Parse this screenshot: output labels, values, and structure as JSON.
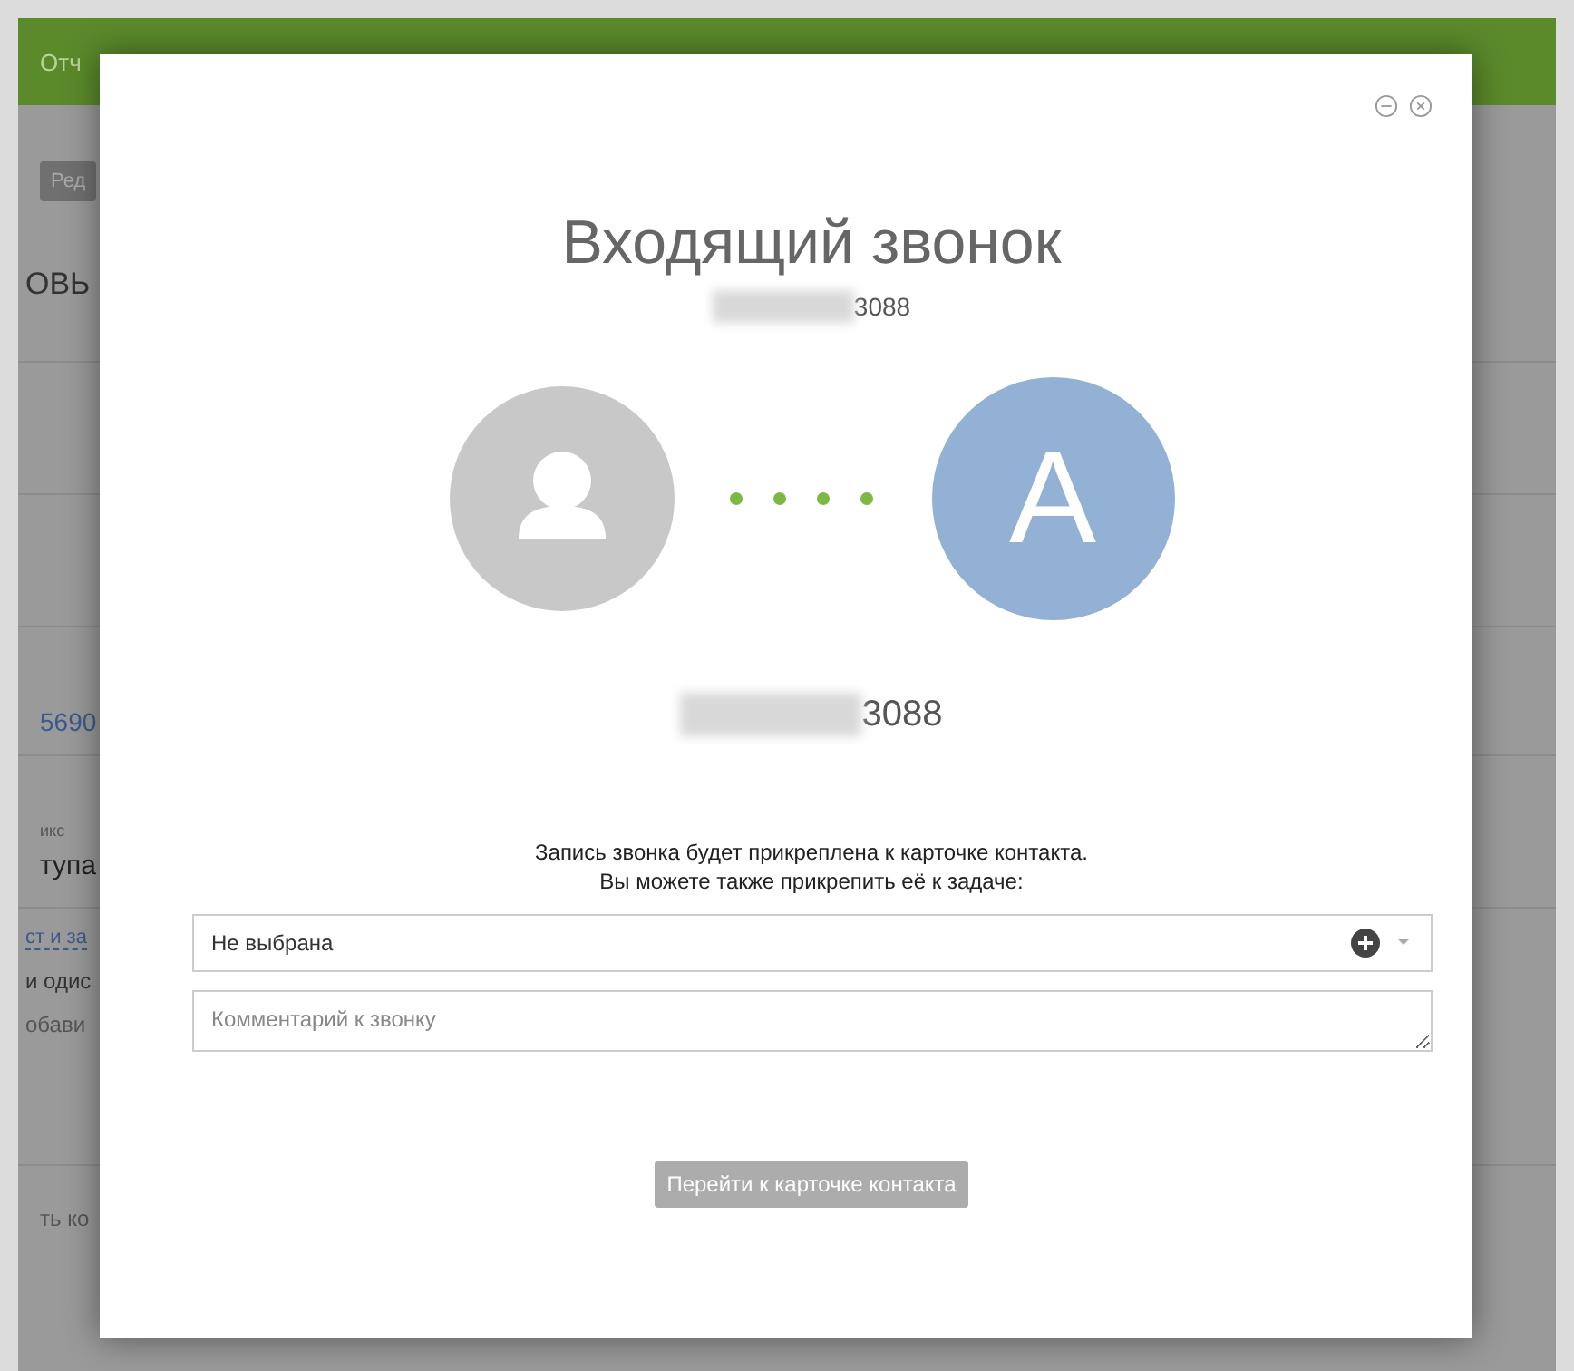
{
  "background": {
    "menu": [
      "Отч"
    ],
    "edit_button": "Ред",
    "heading": "ОВЬ",
    "phone": "5690",
    "field_label": "икс",
    "field_value": "тупа",
    "link": "ст и за",
    "line_1": "и одис",
    "line_2": "обави",
    "footer": "ть ко"
  },
  "dialog": {
    "title": "Входящий звонок",
    "caller_number": "3088",
    "agent_initial": "A",
    "contact_number": "3088",
    "notice": [
      "Запись звонка будет прикреплена к карточке контакта.",
      "Вы можете также прикрепить её к задаче:"
    ],
    "task_select": {
      "value": "Не выбрана"
    },
    "comment": {
      "placeholder": "Комментарий к звонку"
    },
    "button": {
      "label": "Перейти к карточке контакта",
      "disabled": true
    }
  }
}
